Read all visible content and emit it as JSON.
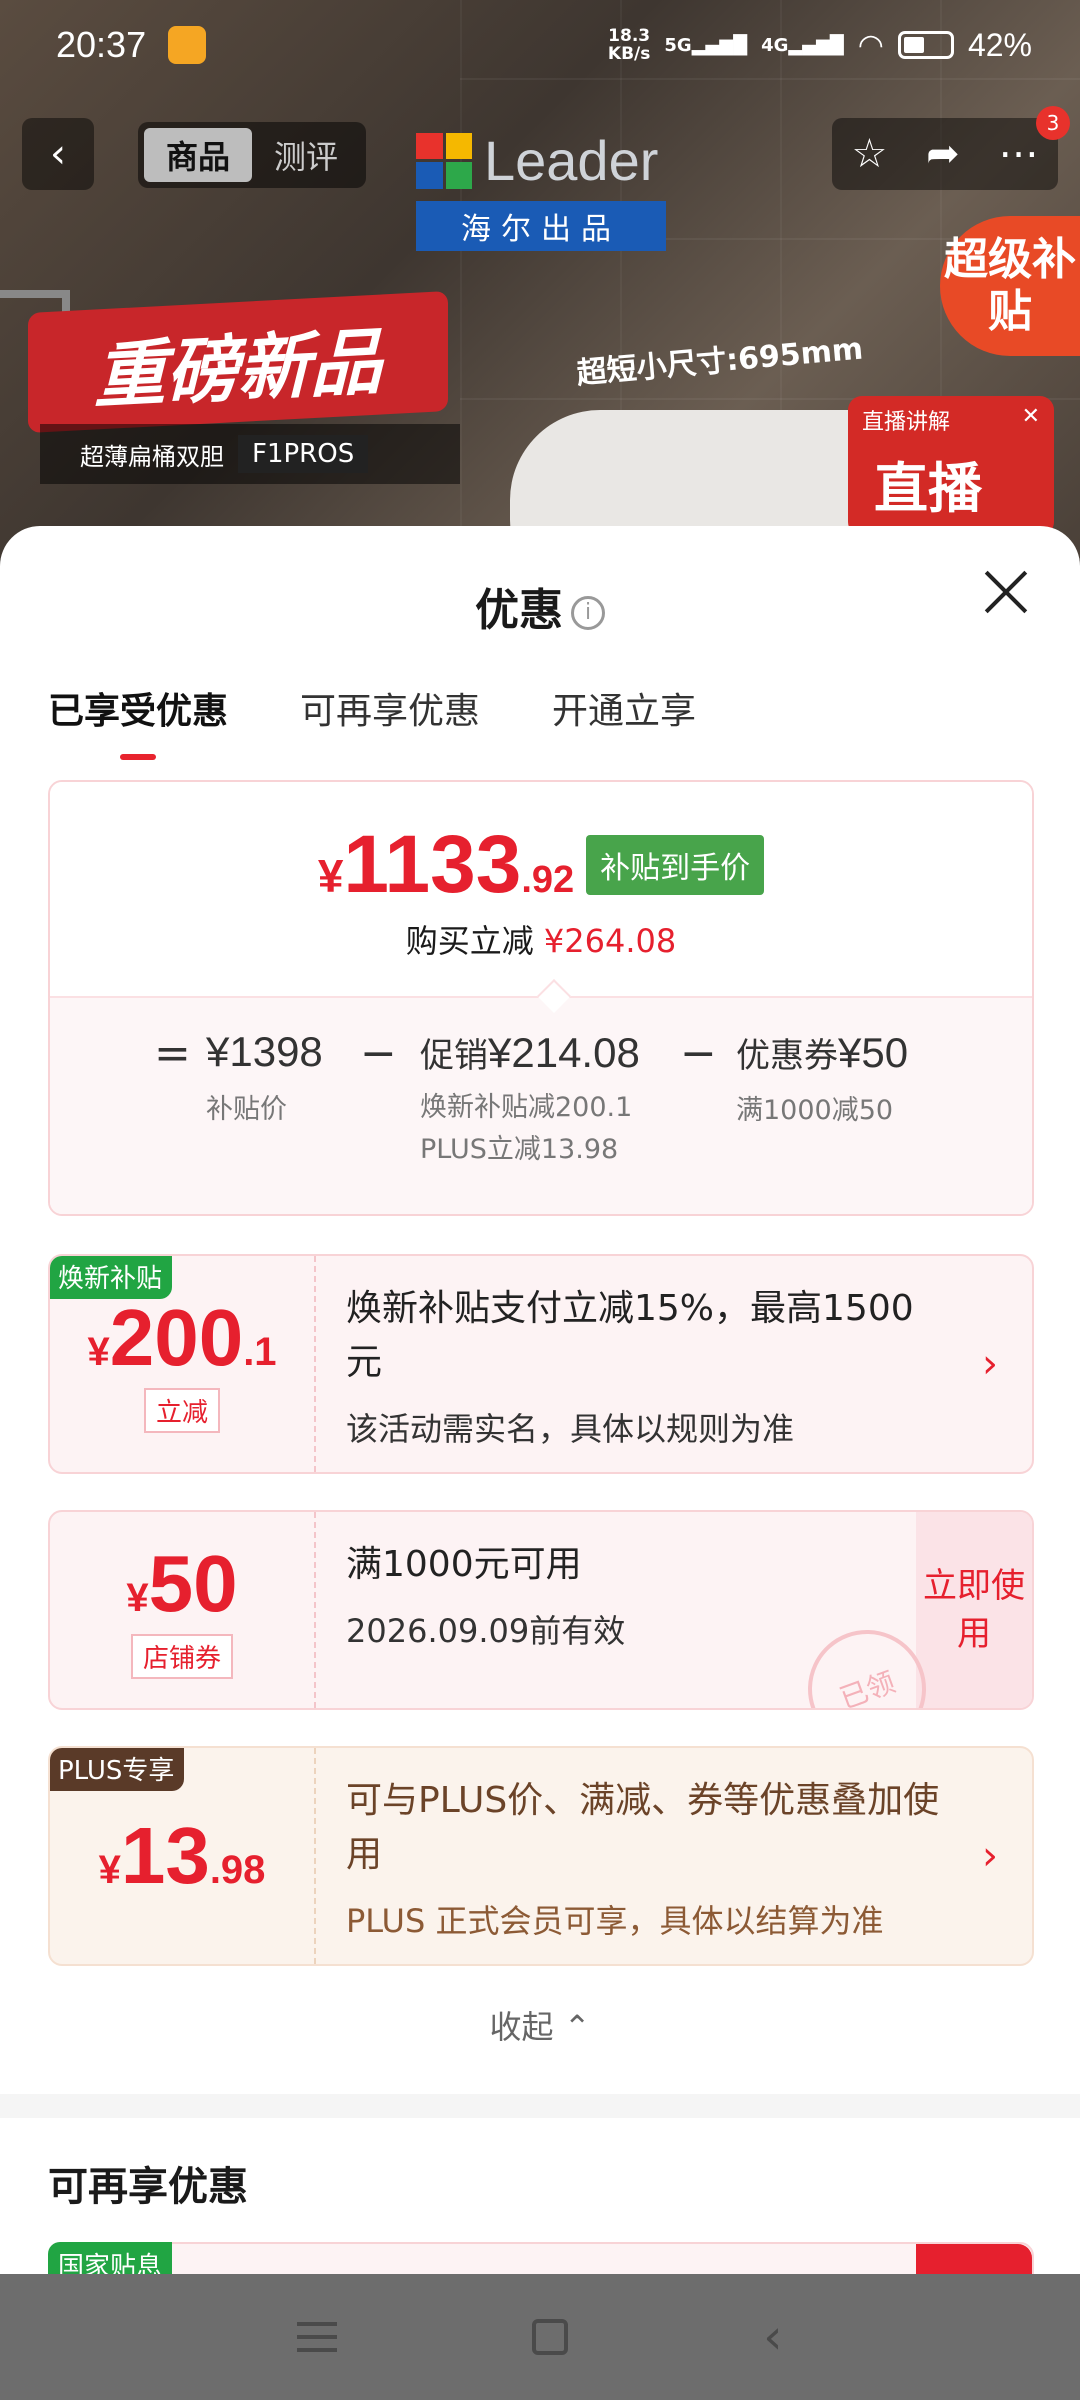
{
  "status_bar": {
    "time": "20:37",
    "net_speed_top": "18.3",
    "net_speed_bottom": "KB/s",
    "sig1": "5G",
    "sig2": "4G",
    "battery": "42%"
  },
  "product_nav": {
    "tabs": [
      "商品",
      "测评"
    ],
    "brand": "Leader",
    "brand_sub": "海尔出品",
    "badge_count": "3"
  },
  "hero": {
    "promo_title": "重磅新品",
    "promo_sub": "超薄扁桶双胆",
    "model": "F1PROS",
    "size_label": "超短小尺寸:695mm",
    "super_subsidy": "超级补贴",
    "live_label": "直播讲解",
    "live_big": "直播"
  },
  "sheet": {
    "title": "优惠",
    "tabs": [
      "已享受优惠",
      "可再享优惠",
      "开通立享"
    ],
    "summary": {
      "currency": "¥",
      "price_int": "1133",
      "price_dec": ".92",
      "tag": "补贴到手价",
      "save_label": "购买立减",
      "save_amount": "¥264.08",
      "eq": "=",
      "minus": "−",
      "base_price": "¥1398",
      "base_label": "补贴价",
      "promo_label": "促销",
      "promo_amount": "¥214.08",
      "promo_sub1": "焕新补贴减200.1",
      "promo_sub2": "PLUS立减13.98",
      "coupon_label": "优惠券",
      "coupon_amount": "¥50",
      "coupon_sub": "满1000减50"
    },
    "coupons": [
      {
        "corner": "焕新补贴",
        "currency": "¥",
        "int": "200",
        "dec": ".1",
        "btag": "立减",
        "title": "焕新补贴支付立减15%，最高1500元",
        "desc": "该活动需实名，具体以规则为准"
      },
      {
        "corner": "",
        "currency": "¥",
        "int": "50",
        "dec": "",
        "btag": "店铺券",
        "title": "满1000元可用",
        "desc": "2026.09.09前有效",
        "use_btn": "立即使用",
        "stamp": "已领"
      },
      {
        "corner": "PLUS专享",
        "currency": "¥",
        "int": "13",
        "dec": ".98",
        "btag": "",
        "title": "可与PLUS价、满减、券等优惠叠加使用",
        "desc": "PLUS 正式会员可享，具体以结算为准"
      }
    ],
    "collapse": "收起",
    "section2_title": "可再享优惠",
    "section2_corner": "国家贴息"
  },
  "colors": {
    "accent_red": "#e6202e",
    "green": "#21a543",
    "plus_brown": "#5a3a28"
  }
}
